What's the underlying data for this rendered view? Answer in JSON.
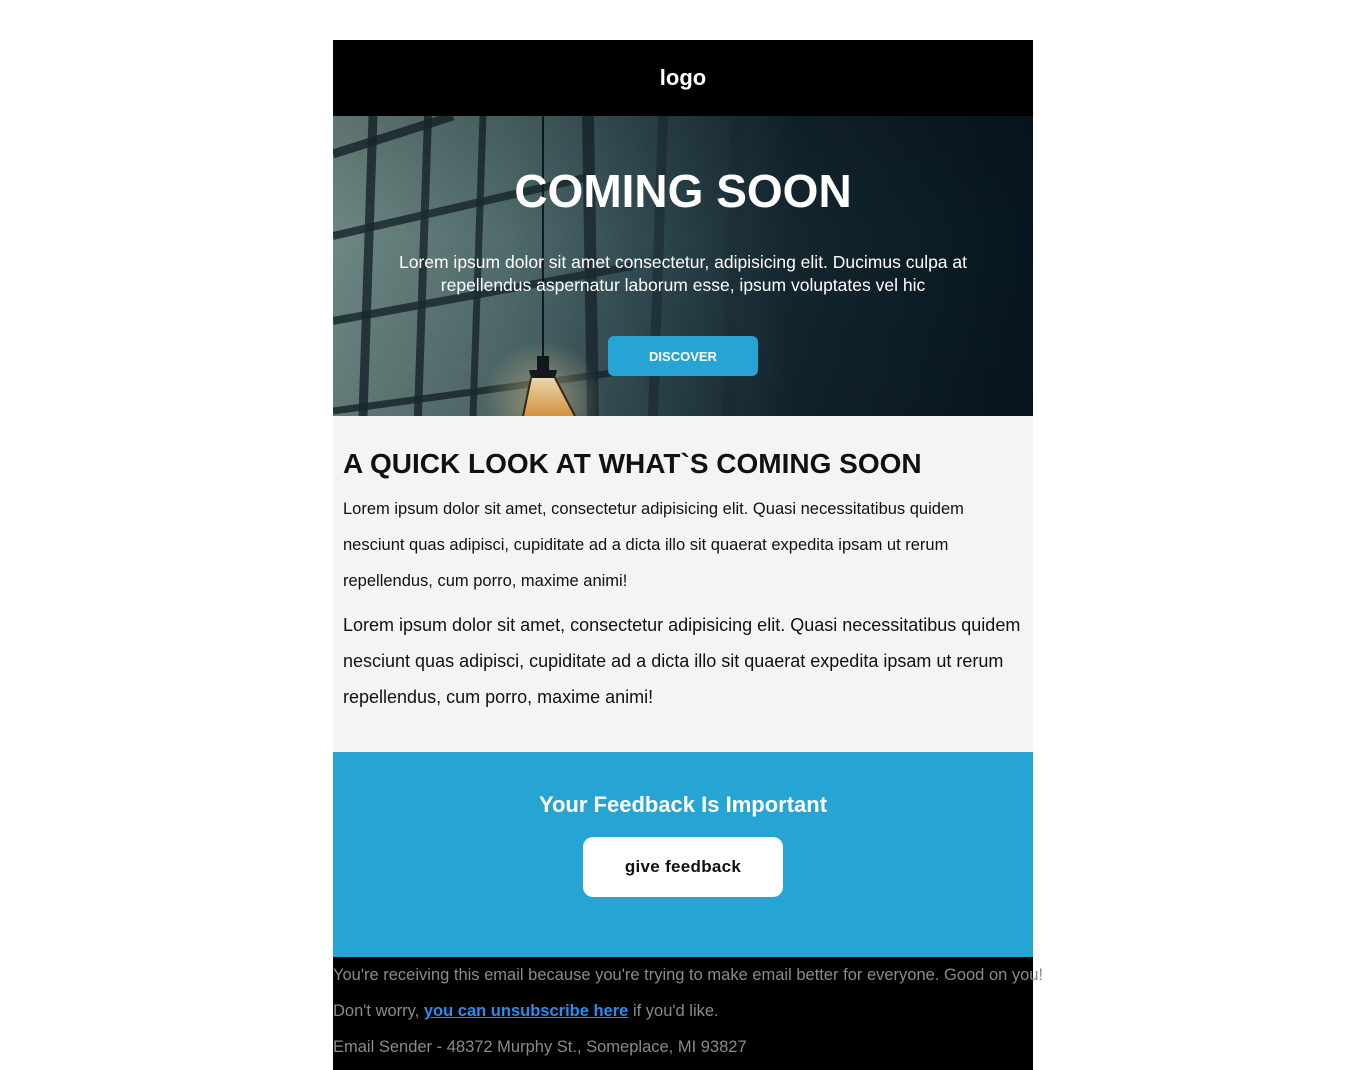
{
  "header": {
    "logo_text": "logo"
  },
  "hero": {
    "title": "COMING SOON",
    "text": "Lorem ipsum dolor sit amet consectetur, adipisicing elit. Ducimus culpa at repellendus aspernatur laborum esse, ipsum voluptates vel hic",
    "button_label": "DISCOVER",
    "button_color": "#26a4d4"
  },
  "content": {
    "heading": "A QUICK LOOK AT WHAT`S COMING SOON",
    "paragraph_1": "Lorem ipsum dolor sit amet, consectetur adipisicing elit. Quasi necessitatibus quidem nesciunt quas adipisci, cupiditate ad a dicta illo sit quaerat expedita ipsam ut rerum repellendus, cum porro, maxime animi!",
    "paragraph_2": "Lorem ipsum dolor sit amet, consectetur adipisicing elit. Quasi necessitatibus quidem nesciunt quas adipisci, cupiditate ad a dicta illo sit quaerat expedita ipsam ut rerum repellendus, cum porro, maxime animi!"
  },
  "feedback": {
    "title": "Your Feedback Is Important",
    "button_label": "give feedback",
    "background_color": "#26a4d4"
  },
  "footer": {
    "line_1": "You're receiving this email because you're trying to make email better for everyone. Good on you!",
    "line_2_prefix": "Don't worry, ",
    "unsubscribe_link": "you can unsubscribe here",
    "line_2_suffix": " if you'd like.",
    "address": "Email Sender - 48372 Murphy St., Someplace, MI 93827",
    "link_color": "#2b8cf0"
  }
}
